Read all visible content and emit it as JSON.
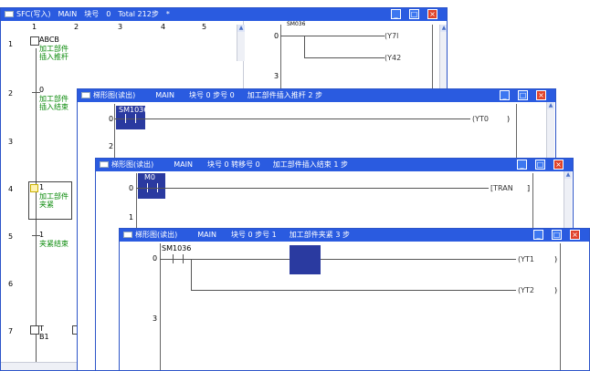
{
  "w1": {
    "title": "SFC(写入)",
    "main": "MAIN",
    "blk_label": "块号",
    "blk": "0",
    "total": "Total  212步",
    "star": "*",
    "cols": [
      "1",
      "2",
      "3",
      "4",
      "5"
    ],
    "rows": [
      "1",
      "2",
      "3",
      "4",
      "5",
      "6",
      "7"
    ],
    "s1": "ABCB",
    "s1a": "加工部件",
    "s1b": "插入推杆",
    "s2n": "0",
    "s2a": "加工部件",
    "s2b": "插入结束",
    "s4n": "1",
    "s4a": "加工部件",
    "s4b": "夹紧",
    "s5n": "1",
    "s5a": "夹紧结束",
    "s7a": "T",
    "s7b": "B1"
  },
  "w1r": {
    "contact": "SM036",
    "coil1": "(Y7l",
    "coil2": "(Y42",
    "r0": "0",
    "r3": "3"
  },
  "w2": {
    "title": "梯形图(读出)",
    "main": "MAIN",
    "info": "块号 0 步号 0",
    "desc": "加工部件插入推杆 2 步",
    "contact": "SM1036",
    "coil": "(YT0",
    "r0": "0",
    "r2": "2"
  },
  "w3": {
    "title": "梯形图(读出)",
    "main": "MAIN",
    "info": "块号 0 转移号 0",
    "desc": "加工部件插入结束 1 步",
    "contact": "M0",
    "coil": "[TRAN",
    "r0": "0",
    "r1": "1"
  },
  "w4": {
    "title": "梯形图(读出)",
    "main": "MAIN",
    "info": "块号 0 步号 1",
    "desc": "加工部件夹紧 3 步",
    "contact": "SM1036",
    "coil1": "(YT1",
    "coil2": "(YT2",
    "r0": "0",
    "r3": "3"
  }
}
